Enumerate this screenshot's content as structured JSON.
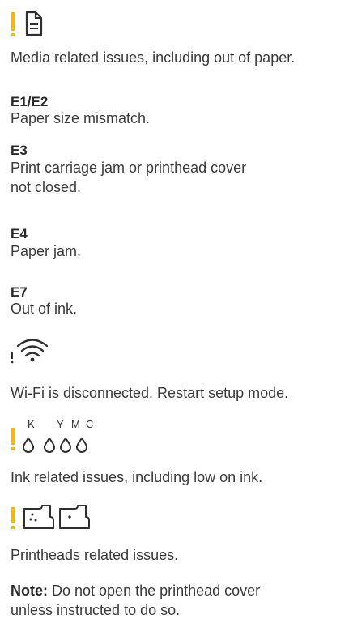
{
  "colors": {
    "warning": "#f5b800",
    "text": "#3a3a3a",
    "icon": "#2f2f2f"
  },
  "media": {
    "icon": "document-icon",
    "description": "Media related issues, including out of paper."
  },
  "errors": [
    {
      "code": "E1/E2",
      "lines": [
        "Paper size mismatch."
      ]
    },
    {
      "code": "E3",
      "lines": [
        "Print carriage jam or printhead cover",
        "not closed."
      ]
    },
    {
      "code": "E4",
      "lines": [
        "Paper jam."
      ]
    },
    {
      "code": "E7",
      "lines": [
        "Out of ink."
      ]
    }
  ],
  "wifi": {
    "icon": "wifi-warning-icon",
    "description": "Wi-Fi is disconnected. Restart setup mode."
  },
  "ink": {
    "icon": "ink-drop-icon",
    "labels": [
      "K",
      "Y",
      "M",
      "C"
    ],
    "description": "Ink related issues, including low on ink."
  },
  "printheads": {
    "icon": "printhead-icon",
    "description": "Printheads related issues."
  },
  "note": {
    "label": "Note:",
    "line1": " Do not open the printhead cover",
    "line2": "unless instructed to do so."
  }
}
